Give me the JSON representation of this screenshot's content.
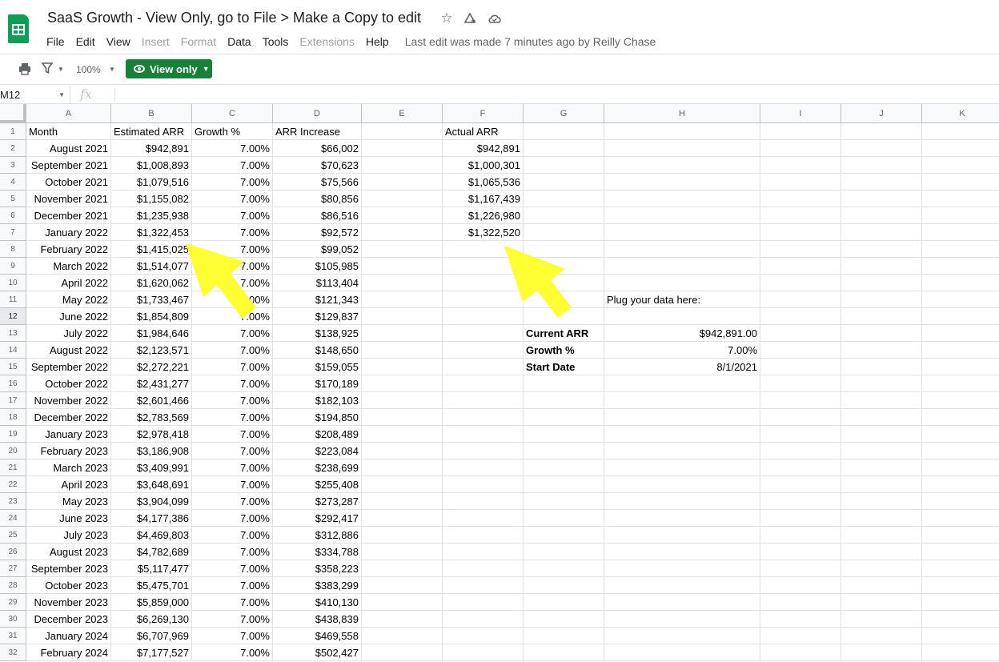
{
  "header": {
    "title": "SaaS Growth - View Only, go to File > Make a Copy to edit",
    "icons": [
      "star-icon",
      "move-to-drive-icon",
      "cloud-status-icon"
    ],
    "menu": [
      {
        "label": "File",
        "disabled": false
      },
      {
        "label": "Edit",
        "disabled": false
      },
      {
        "label": "View",
        "disabled": false
      },
      {
        "label": "Insert",
        "disabled": true
      },
      {
        "label": "Format",
        "disabled": true
      },
      {
        "label": "Data",
        "disabled": false
      },
      {
        "label": "Tools",
        "disabled": false
      },
      {
        "label": "Extensions",
        "disabled": true
      },
      {
        "label": "Help",
        "disabled": false
      }
    ],
    "last_edit": "Last edit was made 7 minutes ago by Reilly Chase"
  },
  "toolbar": {
    "zoom": "100%",
    "view_only_label": "View only"
  },
  "formula_bar": {
    "cell_ref": "M12",
    "fx_label": "fx"
  },
  "columns": [
    "A",
    "B",
    "C",
    "D",
    "E",
    "F",
    "G",
    "H",
    "I",
    "J",
    "K"
  ],
  "selected_row": 12,
  "headers": {
    "month": "Month",
    "estimated_arr": "Estimated ARR",
    "growth": "Growth %",
    "arr_increase": "ARR Increase",
    "actual_arr": "Actual ARR"
  },
  "rows": [
    {
      "month": "August 2021",
      "arr": "$942,891",
      "growth": "7.00%",
      "inc": "$66,002",
      "actual": "$942,891"
    },
    {
      "month": "September 2021",
      "arr": "$1,008,893",
      "growth": "7.00%",
      "inc": "$70,623",
      "actual": "$1,000,301"
    },
    {
      "month": "October 2021",
      "arr": "$1,079,516",
      "growth": "7.00%",
      "inc": "$75,566",
      "actual": "$1,065,536"
    },
    {
      "month": "November 2021",
      "arr": "$1,155,082",
      "growth": "7.00%",
      "inc": "$80,856",
      "actual": "$1,167,439"
    },
    {
      "month": "December 2021",
      "arr": "$1,235,938",
      "growth": "7.00%",
      "inc": "$86,516",
      "actual": "$1,226,980"
    },
    {
      "month": "January 2022",
      "arr": "$1,322,453",
      "growth": "7.00%",
      "inc": "$92,572",
      "actual": "$1,322,520"
    },
    {
      "month": "February 2022",
      "arr": "$1,415,025",
      "growth": "7.00%",
      "inc": "$99,052",
      "actual": ""
    },
    {
      "month": "March 2022",
      "arr": "$1,514,077",
      "growth": "7.00%",
      "inc": "$105,985",
      "actual": ""
    },
    {
      "month": "April 2022",
      "arr": "$1,620,062",
      "growth": "7.00%",
      "inc": "$113,404",
      "actual": ""
    },
    {
      "month": "May 2022",
      "arr": "$1,733,467",
      "growth": "7.00%",
      "inc": "$121,343",
      "actual": ""
    },
    {
      "month": "June 2022",
      "arr": "$1,854,809",
      "growth": "7.00%",
      "inc": "$129,837",
      "actual": ""
    },
    {
      "month": "July 2022",
      "arr": "$1,984,646",
      "growth": "7.00%",
      "inc": "$138,925",
      "actual": ""
    },
    {
      "month": "August 2022",
      "arr": "$2,123,571",
      "growth": "7.00%",
      "inc": "$148,650",
      "actual": ""
    },
    {
      "month": "September 2022",
      "arr": "$2,272,221",
      "growth": "7.00%",
      "inc": "$159,055",
      "actual": ""
    },
    {
      "month": "October 2022",
      "arr": "$2,431,277",
      "growth": "7.00%",
      "inc": "$170,189",
      "actual": ""
    },
    {
      "month": "November 2022",
      "arr": "$2,601,466",
      "growth": "7.00%",
      "inc": "$182,103",
      "actual": ""
    },
    {
      "month": "December 2022",
      "arr": "$2,783,569",
      "growth": "7.00%",
      "inc": "$194,850",
      "actual": ""
    },
    {
      "month": "January 2023",
      "arr": "$2,978,418",
      "growth": "7.00%",
      "inc": "$208,489",
      "actual": ""
    },
    {
      "month": "February 2023",
      "arr": "$3,186,908",
      "growth": "7.00%",
      "inc": "$223,084",
      "actual": ""
    },
    {
      "month": "March 2023",
      "arr": "$3,409,991",
      "growth": "7.00%",
      "inc": "$238,699",
      "actual": ""
    },
    {
      "month": "April 2023",
      "arr": "$3,648,691",
      "growth": "7.00%",
      "inc": "$255,408",
      "actual": ""
    },
    {
      "month": "May 2023",
      "arr": "$3,904,099",
      "growth": "7.00%",
      "inc": "$273,287",
      "actual": ""
    },
    {
      "month": "June 2023",
      "arr": "$4,177,386",
      "growth": "7.00%",
      "inc": "$292,417",
      "actual": ""
    },
    {
      "month": "July 2023",
      "arr": "$4,469,803",
      "growth": "7.00%",
      "inc": "$312,886",
      "actual": ""
    },
    {
      "month": "August 2023",
      "arr": "$4,782,689",
      "growth": "7.00%",
      "inc": "$334,788",
      "actual": ""
    },
    {
      "month": "September 2023",
      "arr": "$5,117,477",
      "growth": "7.00%",
      "inc": "$358,223",
      "actual": ""
    },
    {
      "month": "October 2023",
      "arr": "$5,475,701",
      "growth": "7.00%",
      "inc": "$383,299",
      "actual": ""
    },
    {
      "month": "November 2023",
      "arr": "$5,859,000",
      "growth": "7.00%",
      "inc": "$410,130",
      "actual": ""
    },
    {
      "month": "December 2023",
      "arr": "$6,269,130",
      "growth": "7.00%",
      "inc": "$438,839",
      "actual": ""
    },
    {
      "month": "January 2024",
      "arr": "$6,707,969",
      "growth": "7.00%",
      "inc": "$469,558",
      "actual": ""
    },
    {
      "month": "February 2024",
      "arr": "$7,177,527",
      "growth": "7.00%",
      "inc": "$502,427",
      "actual": ""
    }
  ],
  "inputs": {
    "plug_label": "Plug your data here:",
    "items": [
      {
        "label": "Current ARR",
        "value": "$942,891.00"
      },
      {
        "label": "Growth %",
        "value": "7.00%"
      },
      {
        "label": "Start Date",
        "value": "8/1/2021"
      }
    ]
  },
  "colors": {
    "accent": "#188038",
    "arrow": "#ffff33",
    "logo": "#0f9d58"
  }
}
